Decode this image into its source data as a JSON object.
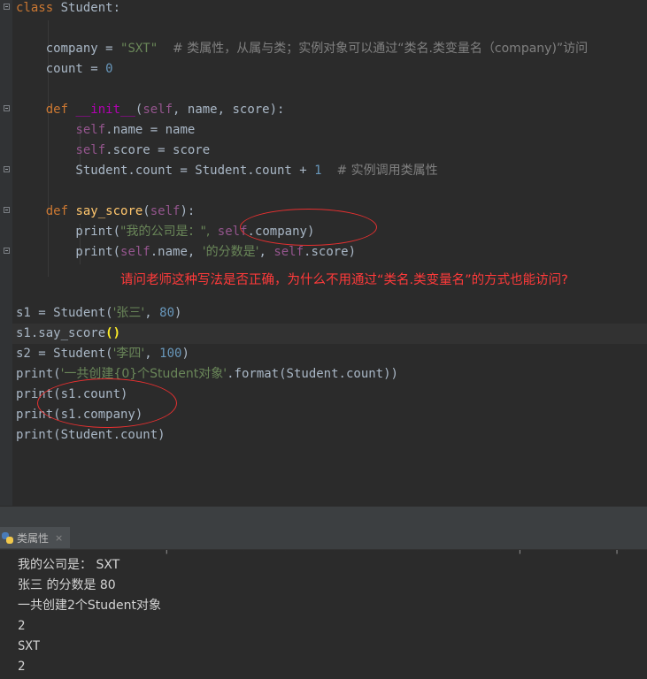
{
  "editor": {
    "lines": [
      "class Student:",
      "",
      "    company = \"SXT\"  # 类属性，从属与类；实例对象可以通过“类名.类变量名（company)”访问",
      "    count = 0",
      "",
      "    def __init__(self, name, score):",
      "        self.name = name",
      "        self.score = score",
      "        Student.count = Student.count + 1  # 实例调用类属性",
      "",
      "    def say_score(self):",
      "        print(\"我的公司是：\", self.company)",
      "        print(self.name, '的分数是', self.score)",
      "",
      "",
      "s1 = Student('张三', 80)",
      "s1.say_score()",
      "s2 = Student('李四', 100)",
      "print('一共创建{0}个Student对象'.format(Student.count))",
      "print(s1.count)",
      "print(s1.company)",
      "print(Student.count)"
    ],
    "annotation": "请问老师这种写法是否正确，为什么不用通过“类名.类变量名”的方式也能访问?"
  },
  "run_panel": {
    "tab_label": "类属性",
    "tab_close": "×",
    "partial_line": "  ‹   ‹       ‹ ‹ ‹ ‹|‹ ‹ ‹     ‹     ‹      ‹ ‹    ‹ ‹  ‹ ‹  ‹    ‹ ‹ ‹|‹   ‹ ‹ ‹ ‹ ‹|‹  ‹",
    "output": [
      "我的公司是： SXT",
      "张三 的分数是 80",
      "一共创建2个Student对象",
      "2",
      "SXT",
      "2"
    ]
  },
  "colors": {
    "background": "#2b2b2b",
    "keyword": "#cc7832",
    "string": "#6a8759",
    "number": "#6897bb",
    "comment": "#808080",
    "self": "#94558d",
    "annotation": "#ff3a3a"
  }
}
